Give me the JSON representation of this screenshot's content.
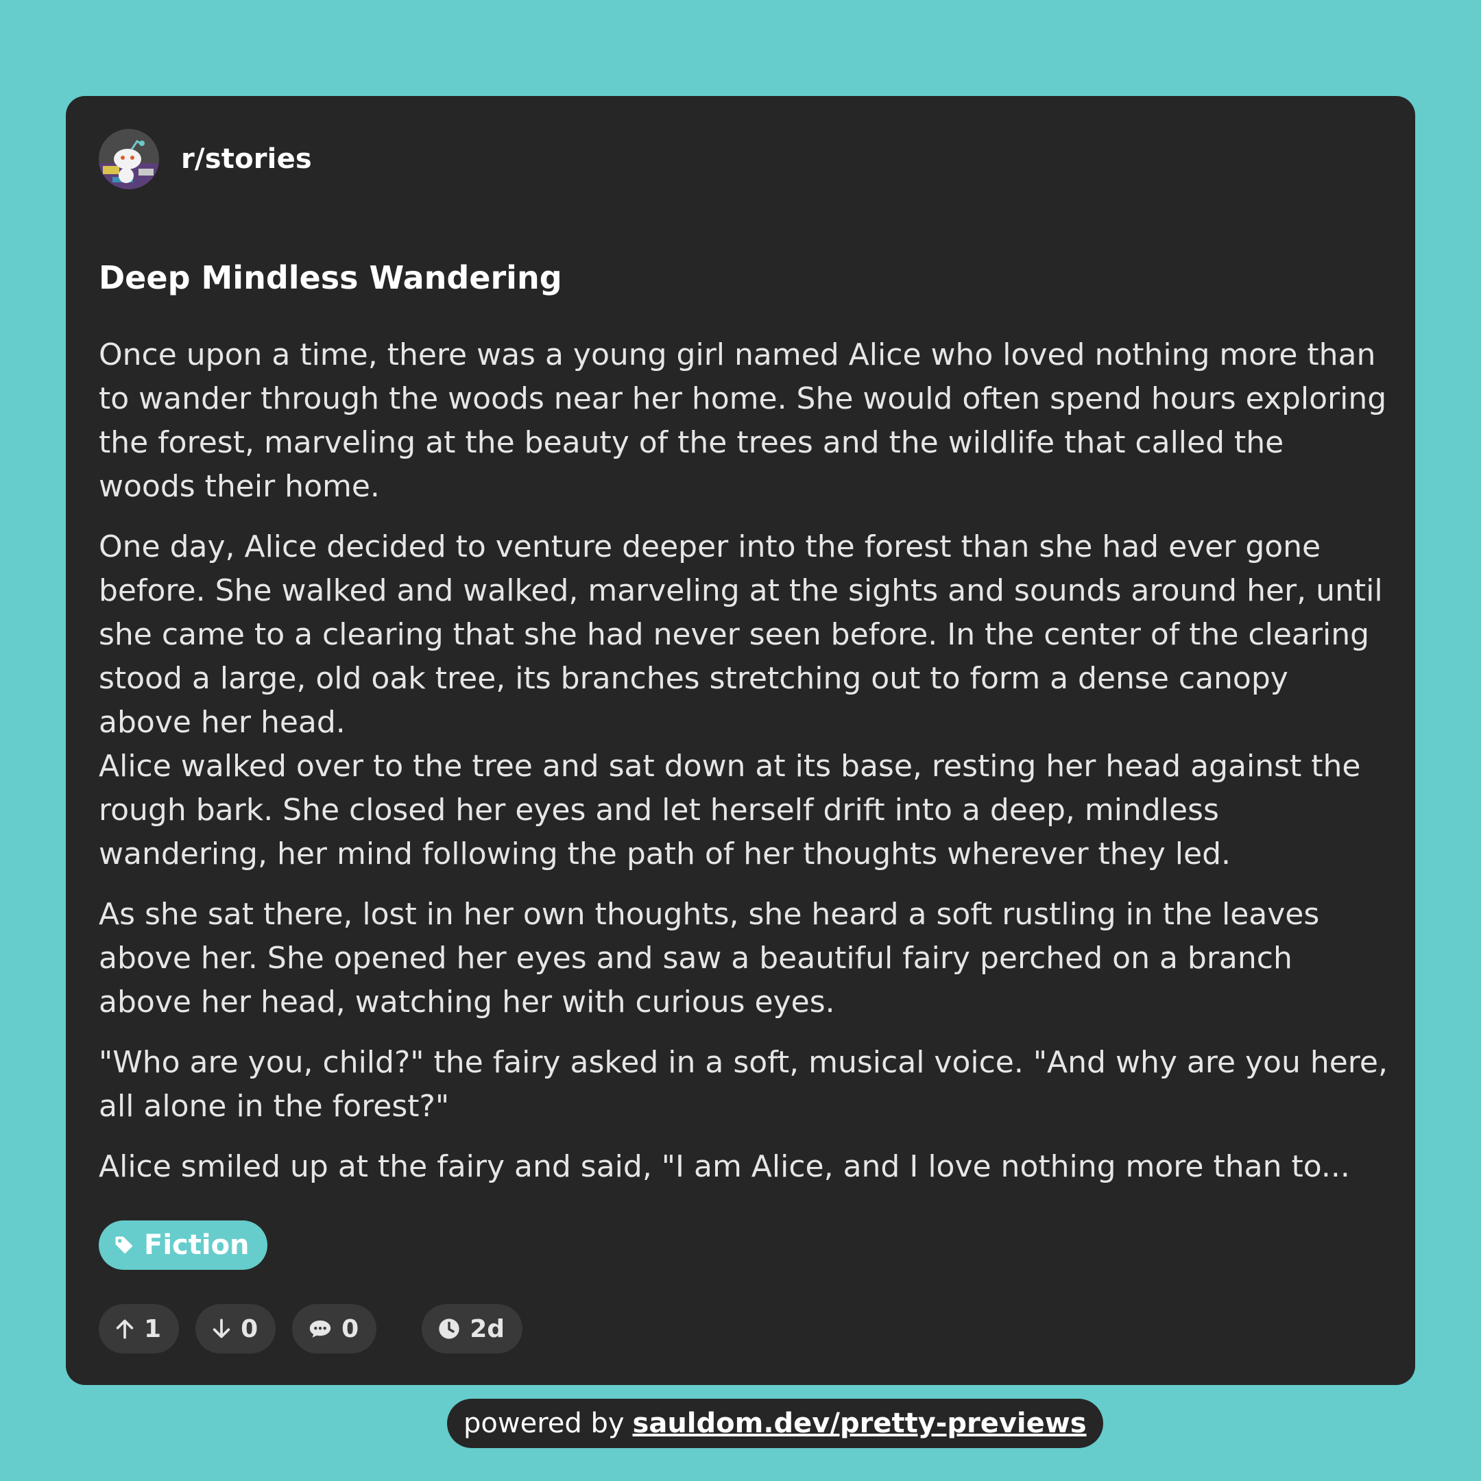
{
  "post": {
    "subreddit": "r/stories",
    "title": "Deep Mindless Wandering",
    "paragraphs": [
      "Once upon a time, there was a young girl named Alice who loved nothing more than to wander through the woods near her home. She would often spend hours exploring the forest, marveling at the beauty of the trees and the wildlife that called the woods their home.",
      "One day, Alice decided to venture deeper into the forest than she had ever gone before. She walked and walked, marveling at the sights and sounds around her, until she came to a clearing that she had never seen before. In the center of the clearing stood a large, old oak tree, its branches stretching out to form a dense canopy above her head.\nAlice walked over to the tree and sat down at its base, resting her head against the rough bark. She closed her eyes and let herself drift into a deep, mindless wandering, her mind following the path of her thoughts wherever they led.",
      "As she sat there, lost in her own thoughts, she heard a soft rustling in the leaves above her. She opened her eyes and saw a beautiful fairy perched on a branch above her head, watching her with curious eyes.",
      "\"Who are you, child?\" the fairy asked in a soft, musical voice. \"And why are you here, all alone in the forest?\"",
      "Alice smiled up at the fairy and said, \"I am Alice, and I love nothing more than to..."
    ],
    "flair": {
      "label": "Fiction",
      "icon": "tag-icon"
    },
    "stats": {
      "upvotes": "1",
      "downvotes": "0",
      "comments": "0",
      "age": "2d"
    }
  },
  "footer": {
    "prefix": "powered by",
    "link": "sauldom.dev/pretty-previews"
  },
  "colors": {
    "background": "#66cdcc",
    "card": "#262626",
    "pill": "#393939",
    "accent": "#66cdcc"
  }
}
